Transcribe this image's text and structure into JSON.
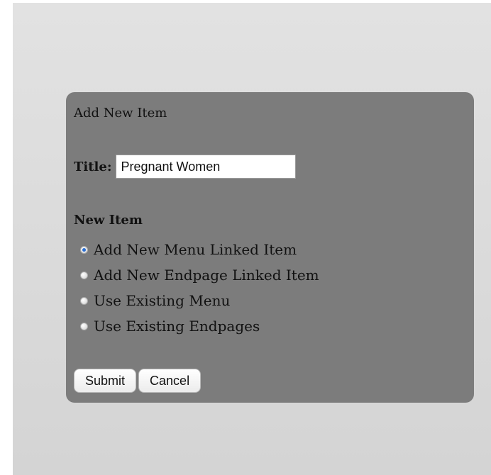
{
  "dialog": {
    "heading": "Add New Item",
    "title_label": "Title:",
    "title_value": "Pregnant Women",
    "group_label": "New Item",
    "options": [
      {
        "label": "Add New Menu Linked Item",
        "selected": true
      },
      {
        "label": "Add New Endpage Linked Item",
        "selected": false
      },
      {
        "label": "Use Existing Menu",
        "selected": false
      },
      {
        "label": "Use Existing Endpages",
        "selected": false
      }
    ],
    "submit_label": "Submit",
    "cancel_label": "Cancel"
  },
  "colors": {
    "panel": "#7c7c7c",
    "backdrop": "#dcdcdc",
    "radio_selected": "#2a6fd3"
  }
}
